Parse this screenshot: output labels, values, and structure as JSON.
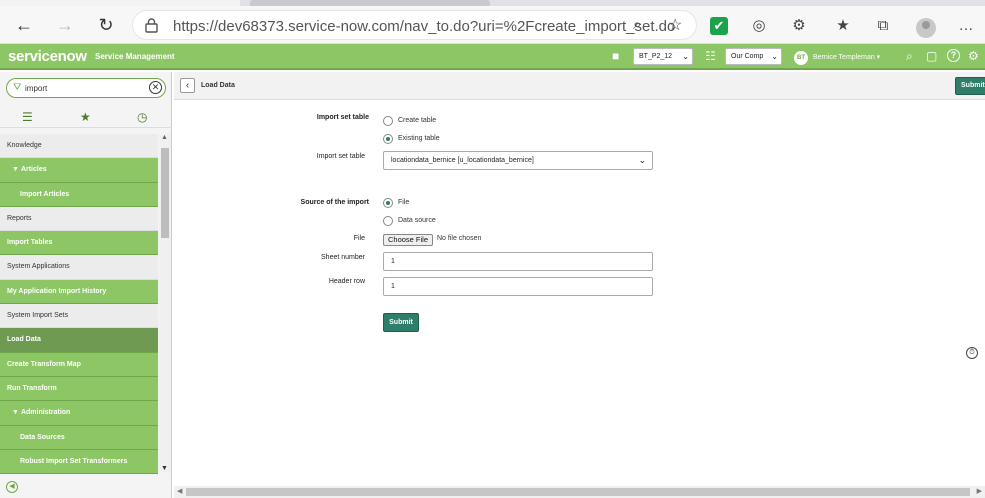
{
  "browser": {
    "url": "https://dev68373.service-now.com/nav_to.do?uri=%2Fcreate_import_set.do",
    "back_icon": "←",
    "forward_icon": "→",
    "refresh_icon": "↻",
    "zoom_icon": "⌕",
    "favorite_icon": "☆",
    "ext_check_icon": "✔",
    "ext_icons": [
      "◎",
      "⚙",
      "★",
      "⧉"
    ],
    "more_icon": "…"
  },
  "header": {
    "logo": "servicenow",
    "product": "Service Management",
    "update_set": "BT_P2_12",
    "company": "Our Comp",
    "user_initials": "BT",
    "user_name": "Bernice Templeman ▾",
    "icons": {
      "search": "⌕",
      "chat": "▢",
      "help": "?",
      "settings": "⚙",
      "tree": "☷",
      "shield": "■"
    }
  },
  "sidebar": {
    "filter_value": "import",
    "filter_icon": "⛛",
    "clear_icon": "✕",
    "tab_icons": [
      "☰",
      "★",
      "◷"
    ],
    "items": [
      {
        "label": "Knowledge",
        "type": "app"
      },
      {
        "label": "Articles",
        "type": "mod",
        "expand": true
      },
      {
        "label": "Import Articles",
        "type": "mod",
        "indent": true
      },
      {
        "label": "Reports",
        "type": "app"
      },
      {
        "label": "Import Tables",
        "type": "mod"
      },
      {
        "label": "System Applications",
        "type": "app"
      },
      {
        "label": "My Application Import History",
        "type": "mod"
      },
      {
        "label": "System Import Sets",
        "type": "app"
      },
      {
        "label": "Load Data",
        "type": "mod",
        "selected": true
      },
      {
        "label": "Create Transform Map",
        "type": "mod"
      },
      {
        "label": "Run Transform",
        "type": "mod"
      },
      {
        "label": "Administration",
        "type": "mod",
        "expand": true
      },
      {
        "label": "Data Sources",
        "type": "mod",
        "indent": true
      },
      {
        "label": "Robust Import Set Transformers",
        "type": "mod",
        "indent": true
      }
    ]
  },
  "content": {
    "title": "Load Data",
    "back_icon": "‹",
    "top_submit": "Submit",
    "form": {
      "import_set_table_label": "Import set table",
      "create_table": "Create table",
      "existing_table": "Existing table",
      "import_set_table_select_label": "Import set table",
      "import_set_table_value": "locationdata_bernice [u_locationdata_bernice]",
      "source_label": "Source of the import",
      "source_file": "File",
      "source_data": "Data source",
      "file_label": "File",
      "choose_file": "Choose File",
      "no_file": "No file chosen",
      "sheet_number_label": "Sheet number",
      "sheet_number": "1",
      "header_row_label": "Header row",
      "header_row": "1",
      "submit": "Submit"
    }
  }
}
